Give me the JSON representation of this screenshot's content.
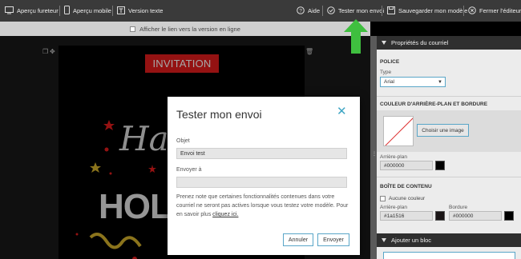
{
  "toolbar": {
    "browser_preview": "Aperçu fureteur",
    "mobile_preview": "Aperçu mobile",
    "text_version": "Version texte",
    "help": "Aide",
    "test_send": "Tester mon envoi",
    "save_model": "Sauvegarder mon modèle",
    "close_editor": "Fermer l'éditeur"
  },
  "subbar": {
    "show_online_link": "Afficher le lien vers la version en ligne"
  },
  "email": {
    "invitation": "INVITATION",
    "ha_text": "Ha",
    "hol_text": "HOL"
  },
  "panel": {
    "properties_header": "Propriétés du courriel",
    "police_section": "POLICE",
    "type_label": "Type",
    "type_value": "Arial",
    "bg_border_section": "COULEUR D'ARRIÈRE-PLAN ET BORDURE",
    "choose_image": "Choisir une image",
    "bg_label": "Arrière-plan",
    "bg_value": "#000000",
    "content_box_section": "BOÎTE DE CONTENU",
    "no_color": "Aucune couleur",
    "content_bg_label": "Arrière-plan",
    "content_bg_value": "#1a1516",
    "border_label": "Bordure",
    "border_value": "#000000",
    "add_block_header": "Ajouter un bloc",
    "colors": {
      "bg": "#000000",
      "content_bg": "#1a1516",
      "border": "#000000"
    }
  },
  "modal": {
    "title": "Tester mon envoi",
    "subject_label": "Objet",
    "subject_value": "Envoi test",
    "send_to_label": "Envoyer à",
    "send_to_value": "",
    "note": "Prenez note que certaines fonctionnalités contenues dans votre courriel ne seront pas actives lorsque vous testez votre modèle. Pour en savoir plus",
    "note_link": "cliquez ici.",
    "cancel": "Annuler",
    "send": "Envoyer"
  },
  "colors": {
    "accent": "#3fa6c4",
    "invite_red": "#e31d1d",
    "arrow_green": "#3fbf3f"
  }
}
